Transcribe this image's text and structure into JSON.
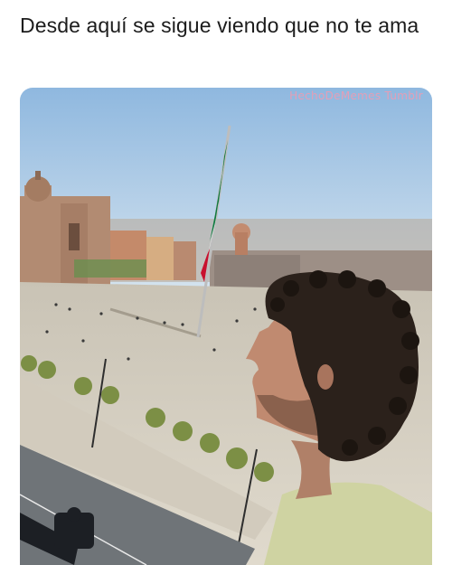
{
  "post": {
    "caption": "Desde aquí se sigue viendo que no te ama",
    "watermark": "HechoDeMemes Tumblr"
  },
  "photo": {
    "subjects": [
      "zocalo-plaza",
      "mexican-flag",
      "cathedral",
      "man-profile",
      "balcony-railing"
    ],
    "flag_colors": {
      "green": "#0f7a3f",
      "white": "#f4f4f4",
      "red": "#c8102e"
    },
    "sky_color": "#aac8e3",
    "plaza_color": "#d8d1c2"
  }
}
